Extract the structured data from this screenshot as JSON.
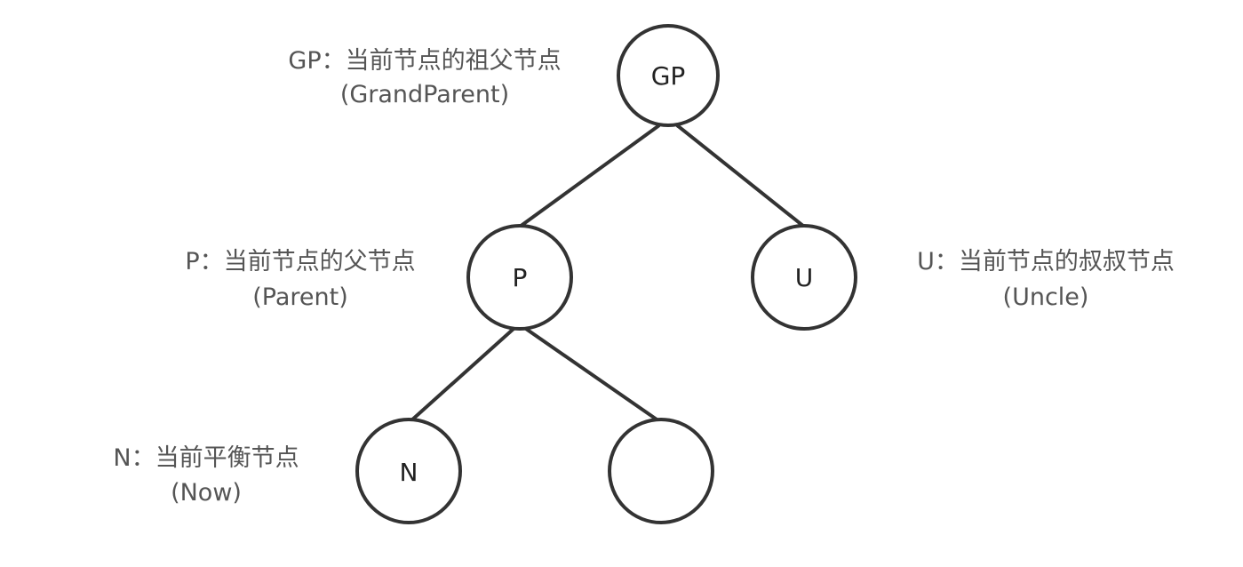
{
  "nodes": {
    "gp": {
      "label": "GP"
    },
    "p": {
      "label": "P"
    },
    "u": {
      "label": "U"
    },
    "n": {
      "label": "N"
    },
    "sibling": {
      "label": ""
    }
  },
  "annotations": {
    "gp": {
      "line1": "GP：当前节点的祖父节点",
      "line2": "(GrandParent)"
    },
    "p": {
      "line1": "P：当前节点的父节点",
      "line2": "(Parent)"
    },
    "u": {
      "line1": "U：当前节点的叔叔节点",
      "line2": "(Uncle)"
    },
    "n": {
      "line1": "N：当前平衡节点",
      "line2": "(Now)"
    }
  },
  "colors": {
    "stroke": "#333333",
    "annotation_text": "#555555",
    "background": "#ffffff"
  }
}
